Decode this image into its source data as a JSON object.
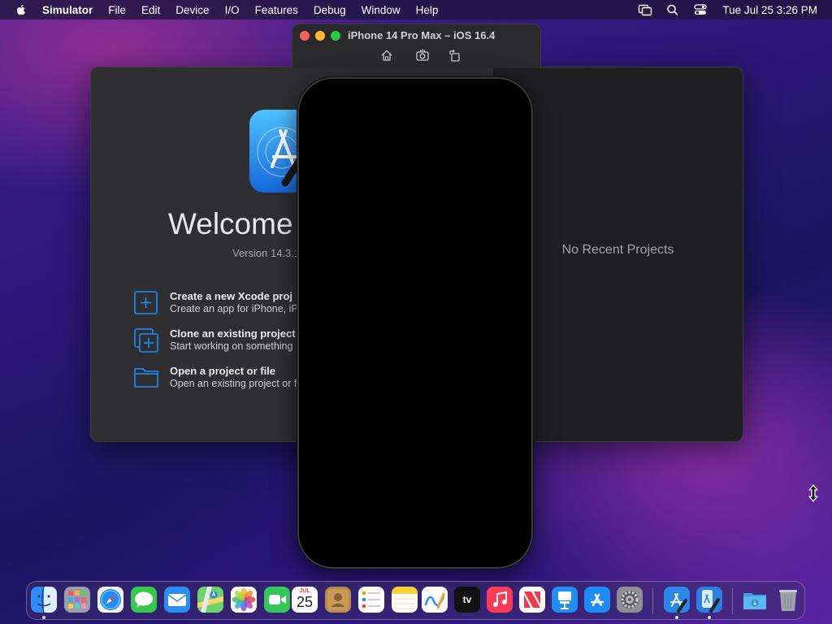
{
  "menubar": {
    "app_name": "Simulator",
    "items": [
      "File",
      "Edit",
      "Device",
      "I/O",
      "Features",
      "Debug",
      "Window",
      "Help"
    ],
    "clock": "Tue Jul 25  3:26 PM"
  },
  "xcode_welcome": {
    "title": "Welcome",
    "version": "Version 14.3.1",
    "actions": [
      {
        "title": "Create a new Xcode proj",
        "description": "Create an app for iPhone, iP",
        "icon": "plus-square-icon"
      },
      {
        "title": "Clone an existing project",
        "description": "Start working on something",
        "icon": "clone-icon"
      },
      {
        "title": "Open a project or file",
        "description": "Open an existing project or f",
        "icon": "folder-icon"
      }
    ],
    "no_recent": "No Recent Projects"
  },
  "simulator": {
    "window_title": "iPhone 14 Pro Max – iOS 16.4",
    "toolbar": [
      "home-icon",
      "screenshot-icon",
      "rotate-icon"
    ]
  },
  "dock": {
    "calendar_month": "JUL",
    "calendar_day": "25",
    "tv_label": "tv",
    "apps": [
      "Finder",
      "Launchpad",
      "Safari",
      "Messages",
      "Mail",
      "Maps",
      "Photos",
      "FaceTime",
      "Calendar",
      "Contacts",
      "Reminders",
      "Notes",
      "Freeform",
      "TV",
      "Music",
      "News",
      "Keynote",
      "App Store",
      "System Settings",
      "Xcode",
      "Simulator",
      "Downloads",
      "Trash"
    ]
  },
  "colors": {
    "accent_blue": "#1e8bff",
    "close": "#fe5f57",
    "minimize": "#febc2e",
    "zoom": "#28c840"
  }
}
